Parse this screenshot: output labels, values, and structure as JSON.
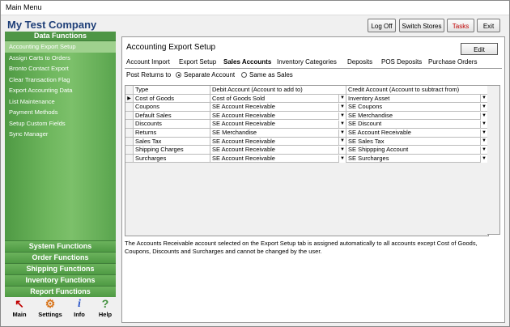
{
  "window": {
    "title": "Main Menu"
  },
  "company": "My Test Company",
  "top_buttons": {
    "log_off": "Log Off",
    "switch_stores": "Switch Stores",
    "tasks": "Tasks",
    "exit": "Exit"
  },
  "sidebar": {
    "header": "Data Functions",
    "items": [
      "Accounting Export Setup",
      "Assign Carts to Orders",
      "Bronto Contact Export",
      "Clear Transaction Flag",
      "Export Accounting Data",
      "List Maintenance",
      "Payment Methods",
      "Setup Custom Fields",
      "Sync Manager"
    ],
    "sections": [
      "System Functions",
      "Order Functions",
      "Shipping Functions",
      "Inventory Functions",
      "Report Functions"
    ]
  },
  "bottom_icons": [
    {
      "label": "Main",
      "icon": "cursor-icon"
    },
    {
      "label": "Settings",
      "icon": "gear-icon"
    },
    {
      "label": "Info",
      "icon": "info-icon"
    },
    {
      "label": "Help",
      "icon": "help-icon"
    }
  ],
  "panel": {
    "title": "Accounting Export Setup",
    "edit_label": "Edit",
    "tabs": [
      "Account Import",
      "Export Setup",
      "Sales Accounts",
      "Inventory Categories",
      "Deposits",
      "POS Deposits",
      "Purchase Orders"
    ],
    "selected_tab": "Sales Accounts",
    "post_returns_label": "Post Returns to",
    "radio_options": [
      "Separate Account",
      "Same as Sales"
    ],
    "radio_selected": "Separate Account",
    "grid": {
      "columns": [
        "Type",
        "Debit Account (Account to add to)",
        "Credit Account (Account to subtract from)"
      ],
      "rows": [
        {
          "type": "Cost of Goods",
          "debit": "Cost of Goods Sold",
          "credit": "Inventory Asset"
        },
        {
          "type": "Coupons",
          "debit": "SE Account Receivable",
          "credit": "SE Coupons"
        },
        {
          "type": "Default Sales",
          "debit": "SE Account Receivable",
          "credit": "SE Merchandise"
        },
        {
          "type": "Discounts",
          "debit": "SE Account Receivable",
          "credit": "SE Discount"
        },
        {
          "type": "Returns",
          "debit": "SE Merchandise",
          "credit": "SE Account Receivable"
        },
        {
          "type": "Sales Tax",
          "debit": "SE Account Receivable",
          "credit": "SE Sales Tax"
        },
        {
          "type": "Shipping Charges",
          "debit": "SE Account Receivable",
          "credit": "SE Shippping Account"
        },
        {
          "type": "Surcharges",
          "debit": "SE Account Receivable",
          "credit": "SE Surcharges"
        }
      ]
    },
    "note": "The Accounts Receivable account selected on the Export Setup tab is assigned automatically to all accounts except Cost of Goods, Coupons, Discounts and Surcharges and cannot be changed by the user."
  },
  "colors": {
    "company": "#1f3f78",
    "sidebar_green": "#5aa54e",
    "tasks_red": "#c00000"
  }
}
